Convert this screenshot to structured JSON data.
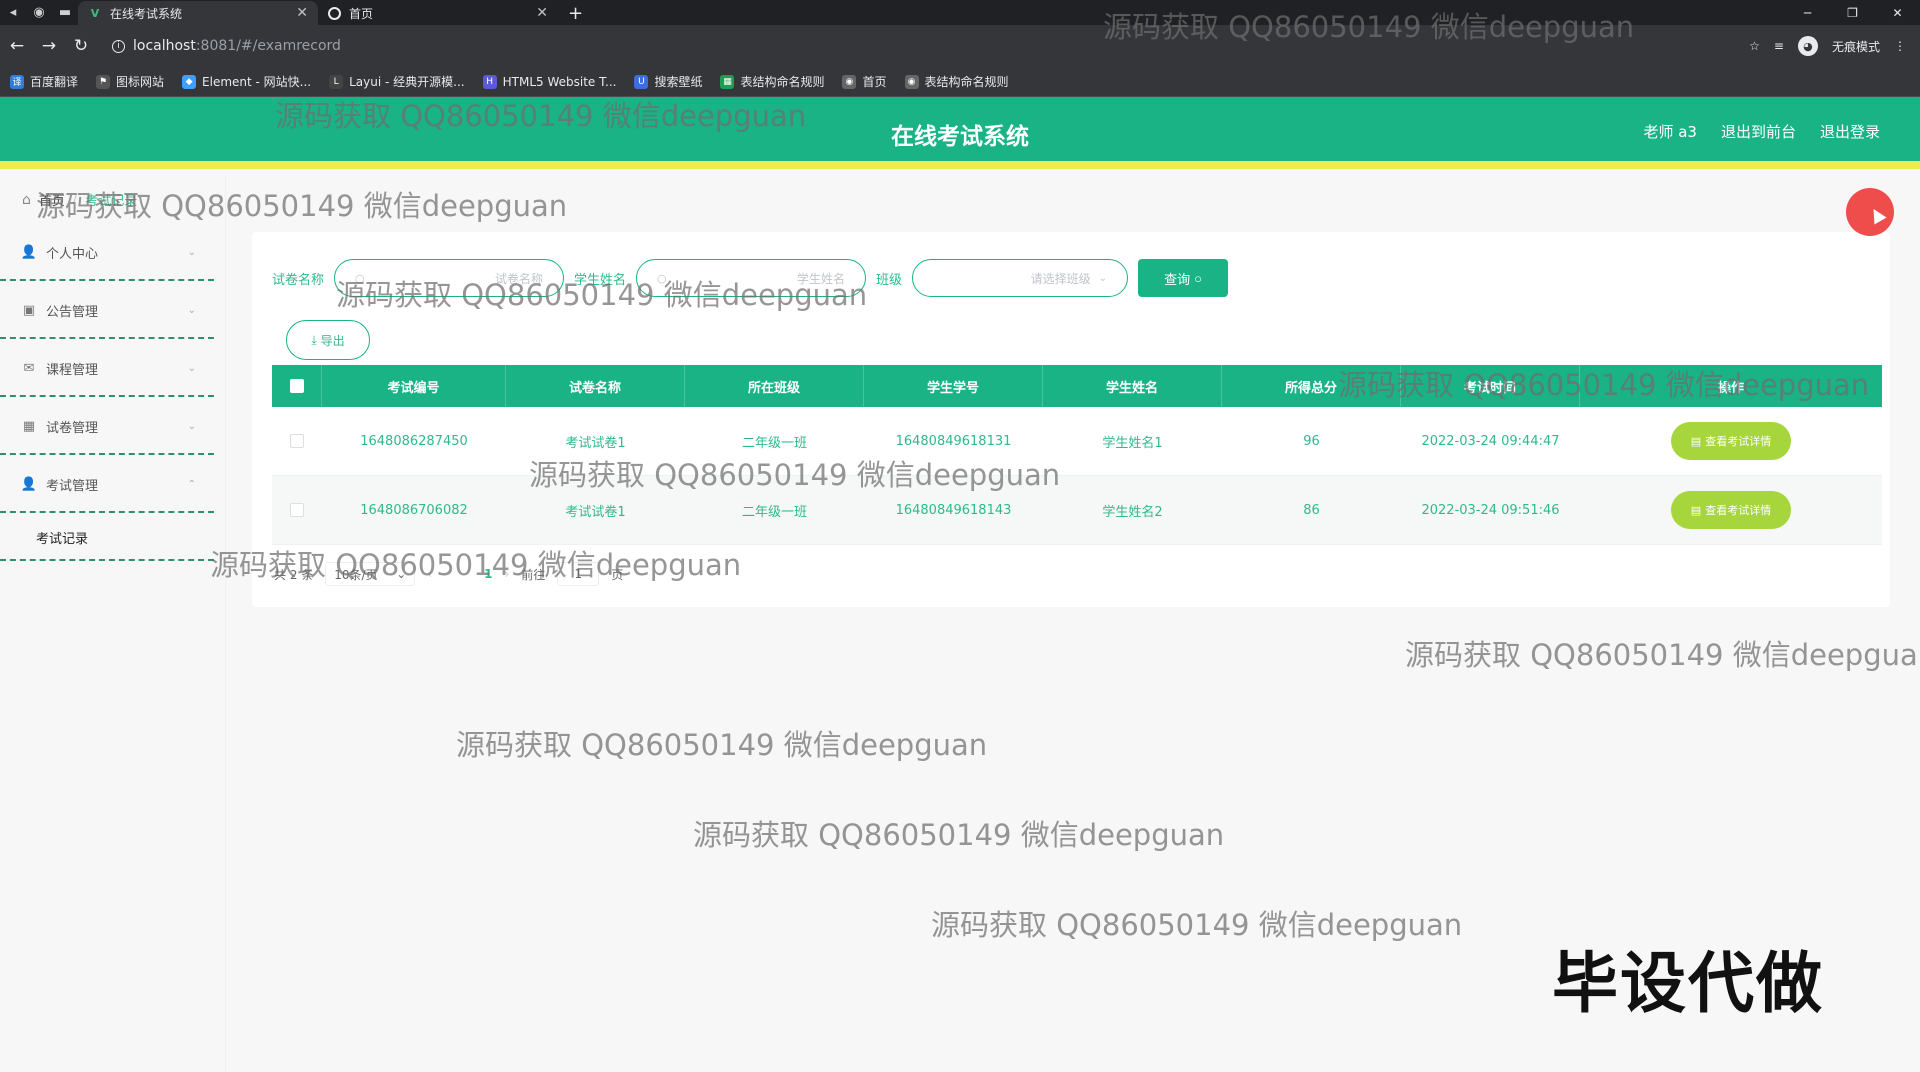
{
  "browser": {
    "tabs": [
      {
        "title": "在线考试系统",
        "active": true,
        "icon": "vue-icon"
      },
      {
        "title": "首页",
        "active": false,
        "icon": "globe-icon"
      }
    ],
    "url_host": "localhost",
    "url_rest": ":8081/#/examrecord",
    "incognito_label": "无痕模式",
    "bookmarks": [
      "百度翻译",
      "图标网站",
      "Element - 网站快...",
      "Layui - 经典开源模...",
      "HTML5 Website T...",
      "搜索壁纸",
      "表结构命名规则",
      "首页",
      "表结构命名规则"
    ]
  },
  "header": {
    "title": "在线考试系统",
    "user": "老师 a3",
    "front_link": "退出到前台",
    "logout_link": "退出登录"
  },
  "breadcrumb": {
    "home": "首页",
    "current": "考试记录"
  },
  "sidebar": {
    "items": [
      {
        "label": "个人中心",
        "icon": "user-icon"
      },
      {
        "label": "公告管理",
        "icon": "notice-icon"
      },
      {
        "label": "课程管理",
        "icon": "mail-icon"
      },
      {
        "label": "试卷管理",
        "icon": "grid-icon"
      },
      {
        "label": "考试管理",
        "icon": "user-icon"
      }
    ],
    "subitems": [
      "考试记录"
    ]
  },
  "search": {
    "paper_label": "试卷名称",
    "paper_placeholder": "试卷名称",
    "student_label": "学生姓名",
    "student_placeholder": "学生姓名",
    "class_label": "班级",
    "class_placeholder": "请选择班级",
    "query_button": "查询"
  },
  "export_button": "导出",
  "table": {
    "columns": [
      "考试编号",
      "试卷名称",
      "所在班级",
      "学生学号",
      "学生姓名",
      "所得总分",
      "考试时间",
      "操作"
    ],
    "rows": [
      {
        "id": "1648086287450",
        "paper": "考试试卷1",
        "class": "二年级一班",
        "student_no": "16480849618131",
        "student_name": "学生姓名1",
        "score": "96",
        "time": "2022-03-24 09:44:47",
        "action": "查看考试详情"
      },
      {
        "id": "1648086706082",
        "paper": "考试试卷1",
        "class": "二年级一班",
        "student_no": "16480849618143",
        "student_name": "学生姓名2",
        "score": "86",
        "time": "2022-03-24 09:51:46",
        "action": "查看考试详情"
      }
    ]
  },
  "pagination": {
    "total": "共 2 条",
    "page_size": "10条/页",
    "current_page": "1",
    "goto_label": "前往",
    "goto_value": "1",
    "page_suffix": "页"
  },
  "overlay": {
    "watermark": "源码获取 QQ86050149 微信deepguan",
    "watermark_cut": "源码获取 QQ86050149 微信deepgua",
    "stamp": "毕设代做"
  },
  "colors": {
    "primary": "#19b386",
    "header_border": "#e8ee4a",
    "detail_button": "#a6d53c"
  }
}
